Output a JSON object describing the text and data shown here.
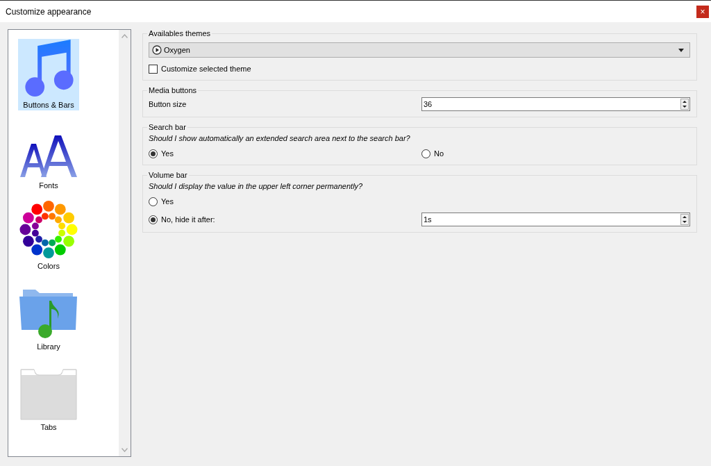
{
  "window": {
    "title": "Customize appearance",
    "close": "×"
  },
  "sidebar": {
    "items": [
      {
        "kind": "note",
        "label": "Buttons & Bars",
        "selected": true
      },
      {
        "kind": "fonts",
        "label": "Fonts",
        "selected": false
      },
      {
        "kind": "colors",
        "label": "Colors",
        "selected": false
      },
      {
        "kind": "library",
        "label": "Library",
        "selected": false
      },
      {
        "kind": "tabs",
        "label": "Tabs",
        "selected": false
      }
    ]
  },
  "groups": [
    {
      "title": "Availables themes",
      "rows": [
        {
          "kind": "combo",
          "value": "Oxygen"
        },
        {
          "kind": "checkbox",
          "label": "Customize selected theme",
          "checked": false
        }
      ]
    },
    {
      "title": "Media buttons",
      "rows": [
        {
          "kind": "spin",
          "label": "Button size",
          "value": "36"
        }
      ]
    },
    {
      "title": "Search bar",
      "rows": [
        {
          "kind": "question",
          "text": "Should I show automatically an extended search area next to the search bar?"
        },
        {
          "kind": "radio_pair",
          "options": [
            {
              "label": "Yes",
              "selected": true
            },
            {
              "label": "No",
              "selected": false
            }
          ]
        }
      ]
    },
    {
      "title": "Volume bar",
      "rows": [
        {
          "kind": "question",
          "text": "Should I display the value in the upper left corner permanently?"
        },
        {
          "kind": "radio",
          "label": "Yes",
          "selected": false
        },
        {
          "kind": "radio_spin",
          "label": "No, hide it after:",
          "selected": true,
          "value": "1s"
        }
      ]
    }
  ]
}
